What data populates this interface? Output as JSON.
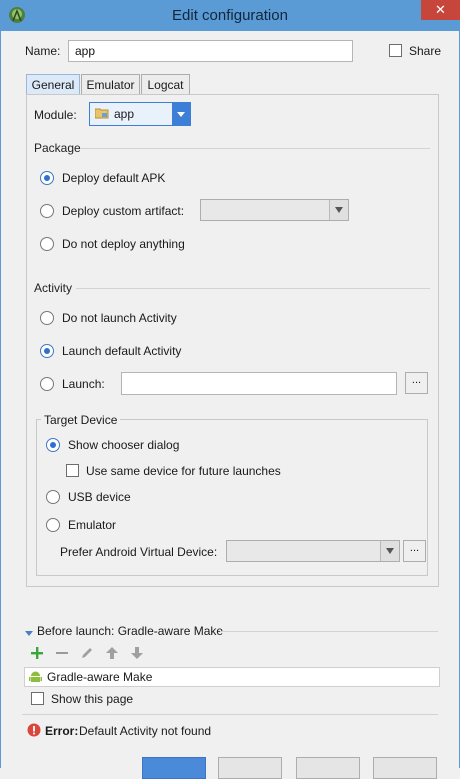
{
  "window": {
    "title": "Edit configuration",
    "close_glyph": "✕"
  },
  "name": {
    "label": "Name:",
    "value": "app",
    "share_label": "Share",
    "share_checked": false
  },
  "tabs": [
    {
      "label": "General",
      "active": true
    },
    {
      "label": "Emulator",
      "active": false
    },
    {
      "label": "Logcat",
      "active": false
    }
  ],
  "module": {
    "label": "Module:",
    "value": "app"
  },
  "package": {
    "heading": "Package",
    "options": [
      {
        "label": "Deploy default APK",
        "selected": true
      },
      {
        "label": "Deploy custom artifact:",
        "selected": false
      },
      {
        "label": "Do not deploy anything",
        "selected": false
      }
    ]
  },
  "activity": {
    "heading": "Activity",
    "options": [
      {
        "label": "Do not launch Activity",
        "selected": false
      },
      {
        "label": "Launch default Activity",
        "selected": true
      },
      {
        "label": "Launch:",
        "selected": false
      }
    ],
    "launch_value": "",
    "browse_label": "..."
  },
  "target_device": {
    "heading": "Target Device",
    "show_chooser_label": "Show chooser dialog",
    "show_chooser_selected": true,
    "same_device_label": "Use same device for future launches",
    "same_device_checked": false,
    "usb_label": "USB device",
    "emulator_label": "Emulator",
    "avd_label": "Prefer Android Virtual Device:",
    "avd_value": "",
    "browse_label": "..."
  },
  "before_launch": {
    "heading": "Before launch: Gradle-aware Make",
    "items": [
      "Gradle-aware Make"
    ],
    "show_page_label": "Show this page",
    "show_page_checked": false
  },
  "error": {
    "prefix": "Error:",
    "message": "Default Activity not found"
  },
  "icons": {
    "app": "android-studio-icon",
    "error": "error-icon",
    "add": "add-icon",
    "remove": "remove-icon",
    "edit": "edit-icon",
    "up": "move-up-icon",
    "down": "move-down-icon",
    "android": "android-icon"
  },
  "colors": {
    "titlebar": "#5b9bd5",
    "close": "#c7463c",
    "accent": "#3875d7",
    "error": "#d9463b",
    "add": "#3aa53a"
  }
}
